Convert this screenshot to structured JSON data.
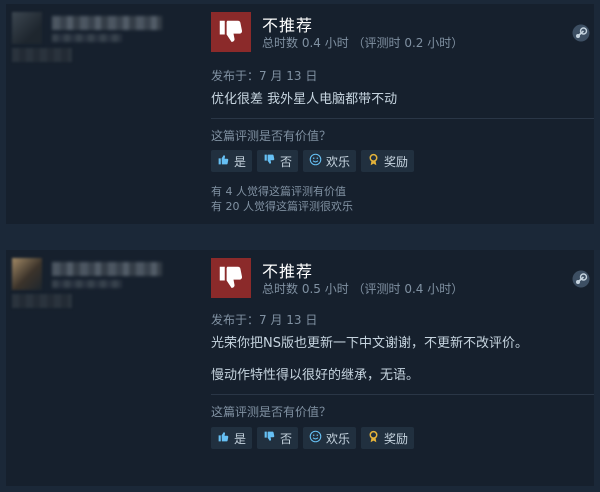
{
  "reviews": [
    {
      "recommendation": "不推荐",
      "hours": "总时数 0.4 小时 （评测时 0.2 小时）",
      "posted": "发布于：7 月 13 日",
      "lines": [
        "优化很差 我外星人电脑都带不动"
      ],
      "helpful_question": "这篇评测是否有价值？",
      "buttons": {
        "yes": "是",
        "no": "否",
        "funny": "欢乐",
        "award": "奖励"
      },
      "counts": [
        "有 4 人觉得这篇评测有价值",
        "有 20 人觉得这篇评测很欢乐"
      ]
    },
    {
      "recommendation": "不推荐",
      "hours": "总时数 0.5 小时 （评测时 0.4 小时）",
      "posted": "发布于：7 月 13 日",
      "lines": [
        "光荣你把NS版也更新一下中文谢谢，不更新不改评价。",
        "慢动作特性得以很好的继承，无语。"
      ],
      "helpful_question": "这篇评测是否有价值？",
      "buttons": {
        "yes": "是",
        "no": "否",
        "funny": "欢乐",
        "award": "奖励"
      }
    }
  ],
  "colors": {
    "thumb_bg": "#8b2a2a",
    "link": "#66c0f4",
    "background": "#1b2838",
    "panel": "#16202d"
  }
}
